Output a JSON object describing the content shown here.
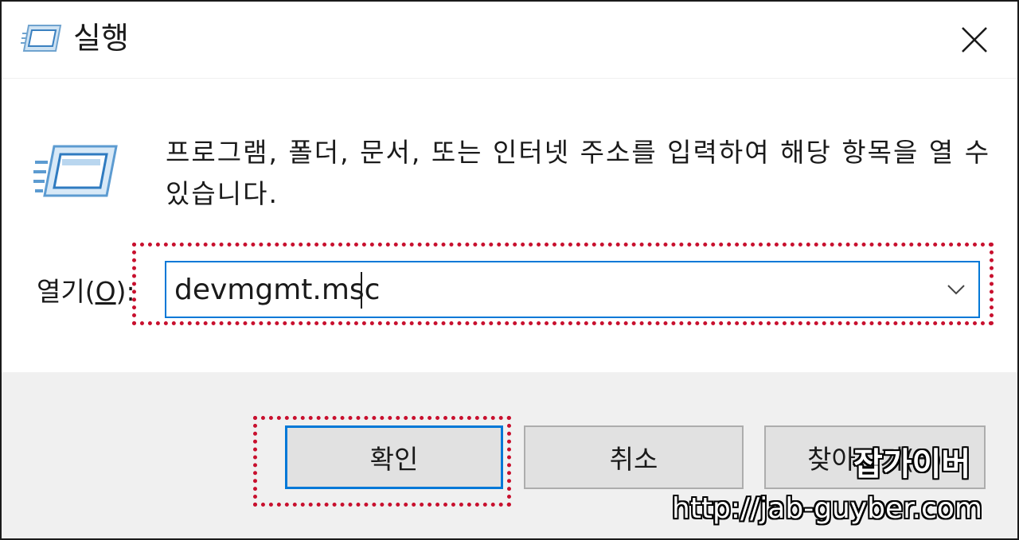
{
  "window": {
    "title": "실행",
    "close_icon": "close-icon",
    "title_icon": "run-icon"
  },
  "dialog": {
    "description": "프로그램, 폴더, 문서, 또는 인터넷 주소를 입력하여 해당 항목을 열 수 있습니다.",
    "open_label_prefix": "열기(",
    "open_label_accesskey": "O",
    "open_label_suffix": "):",
    "open_value": "devmgmt.msc",
    "dropdown_icon": "chevron-down-icon"
  },
  "buttons": {
    "ok": "확인",
    "cancel": "취소",
    "browse": "찾아보기(B)"
  },
  "watermark": {
    "name": "잡가이버",
    "url": "http://jab-guyber.com"
  },
  "colors": {
    "accent": "#0078d7",
    "highlight": "#c8102e",
    "footer_bg": "#f0f0f0",
    "button_bg": "#e1e1e1"
  }
}
